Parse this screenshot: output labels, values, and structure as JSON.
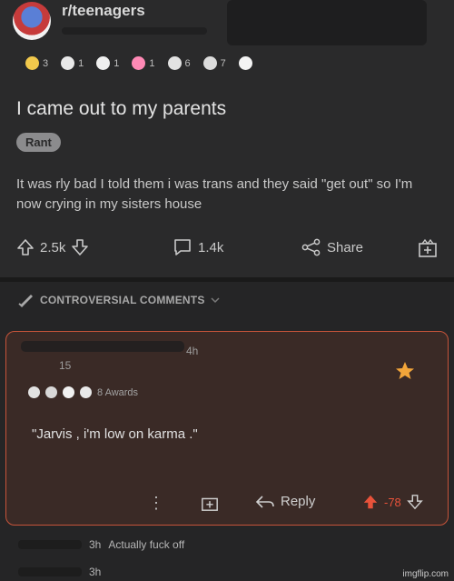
{
  "post": {
    "subreddit": "r/teenagers",
    "title": "I came out to my parents",
    "flair": "Rant",
    "body": "It was rly bad I told them i was trans and they said \"get out\" so I'm now crying in my sisters house",
    "awards": [
      {
        "icon": "laughing-face-icon",
        "count": "3",
        "color": "#f2c94c"
      },
      {
        "icon": "wholesome-seal-icon",
        "count": "1",
        "color": "#e9e9e9"
      },
      {
        "icon": "hugz-icon",
        "count": "1",
        "color": "#f0f0f0"
      },
      {
        "icon": "heart-eyes-icon",
        "count": "1",
        "color": "#ff89b5"
      },
      {
        "icon": "silver-icon",
        "count": "6",
        "color": "#e2e2e2"
      },
      {
        "icon": "helpful-icon",
        "count": "7",
        "color": "#dcdcdc"
      },
      {
        "icon": "bubble-icon",
        "count": "",
        "color": "#f4f4f4"
      }
    ],
    "upvotes": "2.5k",
    "comments": "1.4k",
    "share_label": "Share"
  },
  "sort_label": "CONTROVERSIAL COMMENTS",
  "comment": {
    "time": "4h",
    "score_line": "15",
    "awards_label": "8 Awards",
    "text": "\"Jarvis , i'm low on karma .\"",
    "reply_label": "Reply",
    "vote": "-78"
  },
  "replies": [
    {
      "time": "3h",
      "text": "Actually fuck off"
    },
    {
      "time": "3h",
      "text": ""
    }
  ],
  "watermark": "imgflip.com",
  "colors": {
    "background": "#252526",
    "accent": "#e8523a",
    "comment_border": "#c6543a"
  }
}
